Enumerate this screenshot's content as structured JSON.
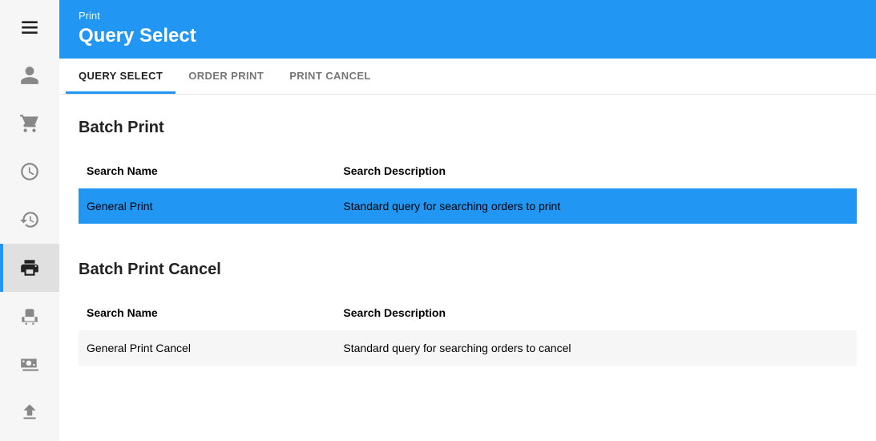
{
  "header": {
    "breadcrumb": "Print",
    "title": "Query Select"
  },
  "tabs": [
    {
      "label": "QUERY SELECT",
      "active": true
    },
    {
      "label": "ORDER PRINT",
      "active": false
    },
    {
      "label": "PRINT CANCEL",
      "active": false
    }
  ],
  "sections": {
    "batch_print": {
      "heading": "Batch Print",
      "col_name": "Search Name",
      "col_desc": "Search Description",
      "rows": [
        {
          "name": "General Print",
          "desc": "Standard query for searching orders to print",
          "selected": true
        }
      ]
    },
    "batch_print_cancel": {
      "heading": "Batch Print Cancel",
      "col_name": "Search Name",
      "col_desc": "Search Description",
      "rows": [
        {
          "name": "General Print Cancel",
          "desc": "Standard query for searching orders to cancel",
          "selected": false
        }
      ]
    }
  },
  "sidebar": {
    "items": [
      {
        "name": "user",
        "active": false
      },
      {
        "name": "cart",
        "active": false
      },
      {
        "name": "clock",
        "active": false
      },
      {
        "name": "history",
        "active": false
      },
      {
        "name": "print",
        "active": true
      },
      {
        "name": "seat",
        "active": false
      },
      {
        "name": "cash",
        "active": false
      },
      {
        "name": "upload",
        "active": false
      }
    ]
  }
}
